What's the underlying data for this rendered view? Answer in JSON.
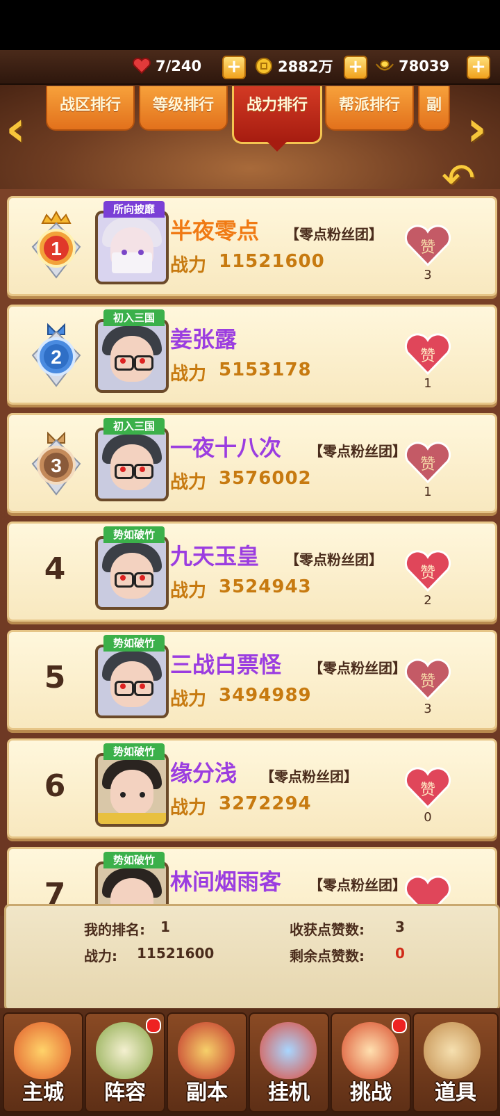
{
  "resources": {
    "stamina": "7/240",
    "coins": "2882万",
    "ingots": "78039",
    "plus": "+"
  },
  "tabs": [
    {
      "label": "战区排行",
      "active": false
    },
    {
      "label": "等级排行",
      "active": false
    },
    {
      "label": "战力排行",
      "active": true
    },
    {
      "label": "帮派排行",
      "active": false
    },
    {
      "label": "副",
      "active": false
    }
  ],
  "arrows": {
    "left": "‹",
    "right": "›",
    "back": "↶"
  },
  "power_label": "战力",
  "like_glyph": "赞",
  "rankings": [
    {
      "rank": "1",
      "title": "所向披靡",
      "title_color": "#7a3fd6",
      "name": "半夜零点",
      "name_color": "#f07a14",
      "guild": "【零点粉丝团】",
      "power": "11521600",
      "likes": "3"
    },
    {
      "rank": "2",
      "title": "初入三国",
      "title_color": "#3bb04a",
      "name": "姜张露",
      "name_color": "#9b3de0",
      "guild": "",
      "power": "5153178",
      "likes": "1"
    },
    {
      "rank": "3",
      "title": "初入三国",
      "title_color": "#3bb04a",
      "name": "一夜十八次",
      "name_color": "#9b3de0",
      "guild": "【零点粉丝团】",
      "power": "3576002",
      "likes": "1"
    },
    {
      "rank": "4",
      "title": "势如破竹",
      "title_color": "#3bb04a",
      "name": "九天玉皇",
      "name_color": "#9b3de0",
      "guild": "【零点粉丝团】",
      "power": "3524943",
      "likes": "2"
    },
    {
      "rank": "5",
      "title": "势如破竹",
      "title_color": "#3bb04a",
      "name": "三战白票怪",
      "name_color": "#9b3de0",
      "guild": "【零点粉丝团】",
      "power": "3494989",
      "likes": "3"
    },
    {
      "rank": "6",
      "title": "势如破竹",
      "title_color": "#3bb04a",
      "name": "缘分浅",
      "name_color": "#9b3de0",
      "guild": "【零点粉丝团】",
      "power": "3272294",
      "likes": "0"
    },
    {
      "rank": "7",
      "title": "势如破竹",
      "title_color": "#3bb04a",
      "name": "林间烟雨客",
      "name_color": "#9b3de0",
      "guild": "【零点粉丝团】",
      "power": "",
      "likes": ""
    }
  ],
  "summary": {
    "my_rank_label": "我的排名:",
    "my_rank": "1",
    "power_label": "战力:",
    "power": "11521600",
    "likes_received_label": "收获点赞数:",
    "likes_received": "3",
    "likes_left_label": "剩余点赞数:",
    "likes_left": "0"
  },
  "nav": [
    {
      "label": "主城",
      "badge": false
    },
    {
      "label": "阵容",
      "badge": true
    },
    {
      "label": "副本",
      "badge": false
    },
    {
      "label": "挂机",
      "badge": false
    },
    {
      "label": "挑战",
      "badge": true
    },
    {
      "label": "道具",
      "badge": false
    }
  ],
  "colors": {
    "accent": "#e2711c",
    "active_tab": "#a61c10",
    "power": "#c77a10",
    "like_red": "#e0465a",
    "remaining_likes": "#d02a18"
  }
}
